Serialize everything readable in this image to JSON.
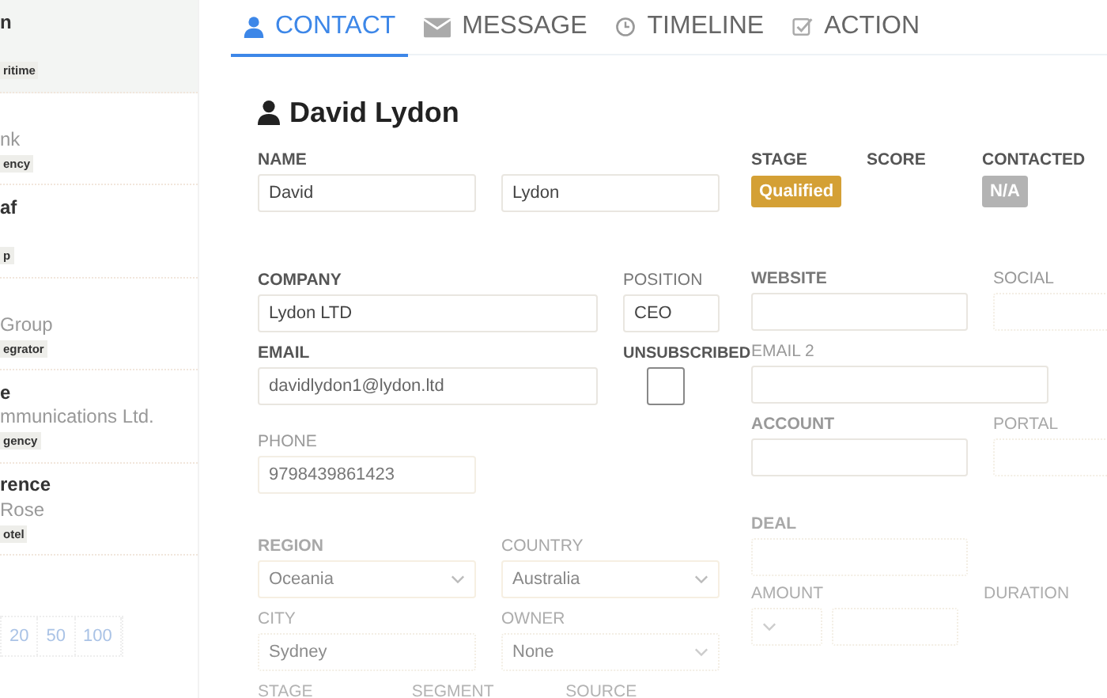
{
  "sidebar": {
    "items": [
      {
        "name": "n",
        "tag": "ritime",
        "selected": true
      },
      {
        "company": "nk",
        "tag": "ency",
        "selected": false
      },
      {
        "name": "af",
        "tag": "p",
        "selected": false
      },
      {
        "company": "Group",
        "tag": "egrator",
        "selected": false
      },
      {
        "name": "e",
        "company": "mmunications Ltd.",
        "tag": "gency",
        "selected": false
      },
      {
        "name": "rence",
        "company": "Rose",
        "tag": "otel",
        "selected": false
      }
    ],
    "page_sizes": [
      "20",
      "50",
      "100"
    ]
  },
  "tabs": [
    {
      "label": "CONTACT",
      "selected": true
    },
    {
      "label": "MESSAGE",
      "selected": false
    },
    {
      "label": "TIMELINE",
      "selected": false
    },
    {
      "label": "ACTION",
      "selected": false
    }
  ],
  "contact": {
    "title": "David Lydon",
    "name": {
      "label": "NAME",
      "first": "David",
      "last": "Lydon"
    },
    "status": [
      {
        "label": "STAGE",
        "badge": "Qualified",
        "color": "#d4a035"
      },
      {
        "label": "SCORE"
      },
      {
        "label": "CONTACTED",
        "badge": "N/A",
        "color": "#b3b3b3"
      }
    ],
    "company": {
      "label": "COMPANY",
      "value": "Lydon LTD"
    },
    "position": {
      "label": "POSITION",
      "value": "CEO"
    },
    "website": {
      "label": "WEBSITE"
    },
    "social": {
      "label": "SOCIAL"
    },
    "email": {
      "label": "EMAIL",
      "value": "davidlydon1@lydon.ltd"
    },
    "unsubscribed": {
      "label": "UNSUBSCRIBED",
      "checked": false
    },
    "email2": {
      "label": "EMAIL 2"
    },
    "account": {
      "label": "ACCOUNT"
    },
    "portal": {
      "label": "PORTAL"
    },
    "phone": {
      "label": "PHONE",
      "value": "9798439861423"
    },
    "deal": {
      "label": "DEAL"
    },
    "region": {
      "label": "REGION",
      "value": "Oceania"
    },
    "country": {
      "label": "COUNTRY",
      "value": "Australia"
    },
    "amount": {
      "label": "AMOUNT"
    },
    "duration": {
      "label": "DURATION"
    },
    "city": {
      "label": "CITY",
      "value": "Sydney"
    },
    "owner": {
      "label": "OWNER",
      "value": "None"
    },
    "classification": [
      {
        "label": "STAGE"
      },
      {
        "label": "SEGMENT"
      },
      {
        "label": "SOURCE"
      }
    ]
  }
}
